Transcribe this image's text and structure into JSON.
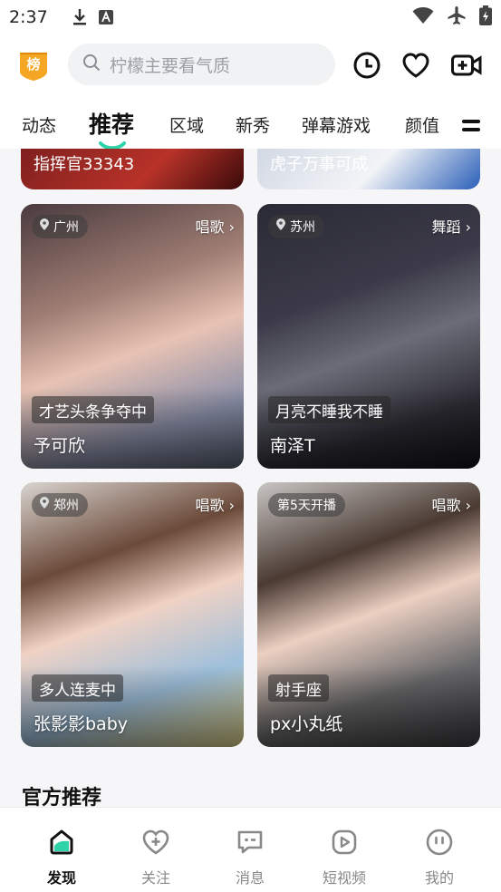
{
  "status_bar": {
    "time": "2:37"
  },
  "header": {
    "badge_text": "榜",
    "search_placeholder": "柠檬主要看气质"
  },
  "tabs": [
    {
      "label": "动态"
    },
    {
      "label": "推荐",
      "active": true
    },
    {
      "label": "区域"
    },
    {
      "label": "新秀"
    },
    {
      "label": "弹幕游戏"
    },
    {
      "label": "颜值"
    }
  ],
  "partial_cards": [
    {
      "name": "指挥官33343"
    },
    {
      "name": "虎子万事可成"
    }
  ],
  "cards": [
    {
      "location": "广州",
      "category": "唱歌",
      "status": "才艺头条争夺中",
      "name": "予可欣"
    },
    {
      "location": "苏州",
      "category": "舞蹈",
      "status": "月亮不睡我不睡",
      "name": "南泽T"
    },
    {
      "location": "郑州",
      "category": "唱歌",
      "status": "多人连麦中",
      "name": "张影影baby"
    },
    {
      "location": "第5天开播",
      "category": "唱歌",
      "status": "射手座",
      "name": "px小丸纸"
    }
  ],
  "section_title": "官方推荐",
  "bottom_nav": [
    {
      "label": "发现",
      "active": true
    },
    {
      "label": "关注"
    },
    {
      "label": "消息"
    },
    {
      "label": "短视频"
    },
    {
      "label": "我的"
    }
  ],
  "colors": {
    "accent": "#2fd3a8",
    "badge": "#f5a623"
  }
}
